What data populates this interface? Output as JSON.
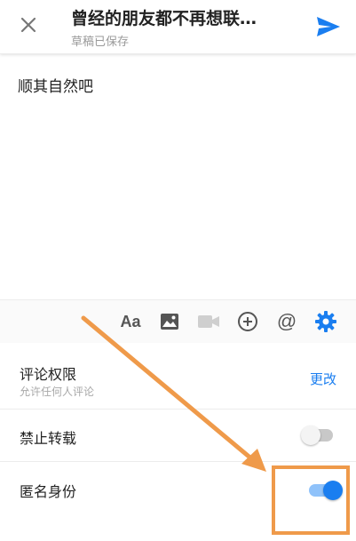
{
  "header": {
    "title": "曾经的朋友都不再想联…",
    "subtitle": "草稿已保存",
    "close_icon": "close-icon",
    "send_icon": "send-icon"
  },
  "body": {
    "text": "顺其自然吧"
  },
  "toolbar": {
    "font_label": "Aa",
    "at_label": "@",
    "icons": [
      "text-format-icon",
      "image-icon",
      "video-icon",
      "add-circle-icon",
      "at-icon",
      "settings-icon"
    ]
  },
  "settings": {
    "comment_permission": {
      "title": "评论权限",
      "subtitle": "允许任何人评论",
      "action": "更改"
    },
    "no_repost": {
      "title": "禁止转载",
      "enabled": false
    },
    "anonymous": {
      "title": "匿名身份",
      "enabled": true
    }
  },
  "colors": {
    "accent": "#1a7ef0",
    "annotation": "#ef9a4a"
  }
}
